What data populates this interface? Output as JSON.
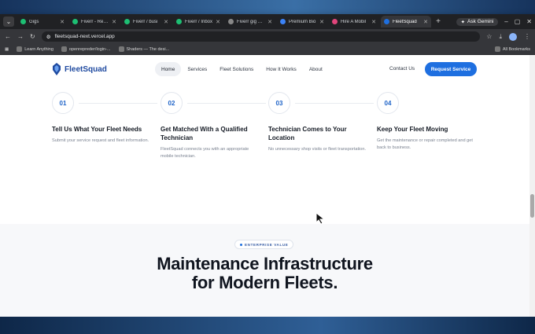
{
  "browser": {
    "tabs": [
      {
        "label": "Gigs",
        "color": "#1dbf73"
      },
      {
        "label": "Fiverr - Remo",
        "color": "#1dbf73"
      },
      {
        "label": "Fiverr / busi",
        "color": "#1dbf73"
      },
      {
        "label": "Fiverr / Inbox",
        "color": "#1dbf73"
      },
      {
        "label": "Fiverr gig pro",
        "color": "#888888"
      },
      {
        "label": "Premium Bio",
        "color": "#3b82f6"
      },
      {
        "label": "Hire A Mobil",
        "color": "#e0457b"
      },
      {
        "label": "FleetSquad",
        "color": "#1e6fe0",
        "active": true
      }
    ],
    "ask_gemini": "Ask Gemini",
    "url": "fleetsquad-next.vercel.app",
    "bookmarks": [
      "Learn Anything",
      "openrepreder/login-...",
      "Shaders — The desi..."
    ],
    "all_bookmarks": "All Bookmarks"
  },
  "site": {
    "brand": "FleetSquad",
    "nav": [
      "Home",
      "Services",
      "Fleet Solutions",
      "How It Works",
      "About"
    ],
    "contact": "Contact Us",
    "cta": "Request Service",
    "steps": [
      {
        "num": "01",
        "title": "Tell Us What Your Fleet Needs",
        "desc": "Submit your service request and fleet information."
      },
      {
        "num": "02",
        "title": "Get Matched With a Qualified Technician",
        "desc": "FleetSquad connects you with an appropriate mobile technician."
      },
      {
        "num": "03",
        "title": "Technician Comes to Your Location",
        "desc": "No unnecessary shop visits or fleet transportation."
      },
      {
        "num": "04",
        "title": "Keep Your Fleet Moving",
        "desc": "Get the maintenance or repair completed and get back to business."
      }
    ],
    "enterprise_pill": "ENTERPRISE VALUE",
    "headline_line1": "Maintenance Infrastructure",
    "headline_line2": "for Modern Fleets."
  },
  "colors": {
    "accent": "#1e6fe0",
    "brand": "#1f4aa0"
  }
}
